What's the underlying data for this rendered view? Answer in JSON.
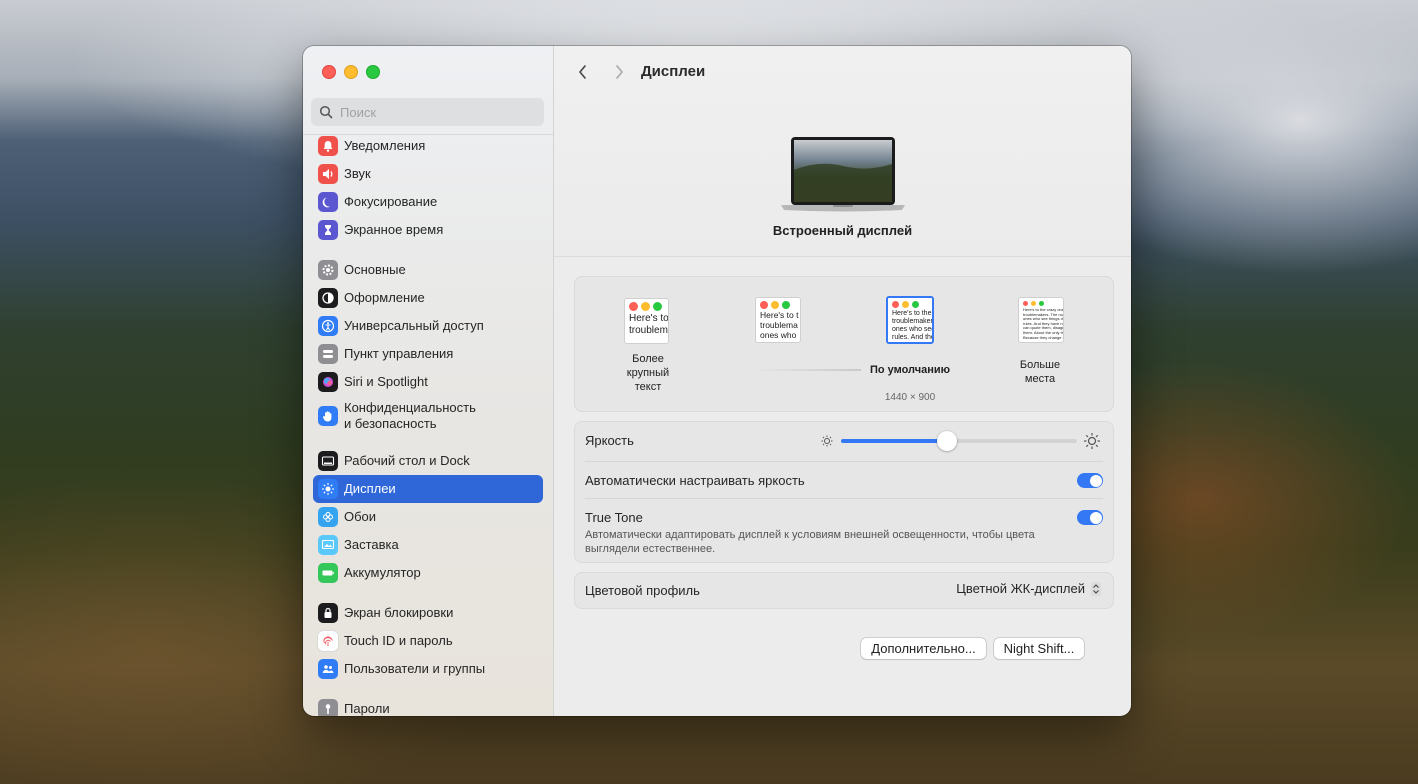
{
  "window": {
    "title": "Дисплеи"
  },
  "search": {
    "placeholder": "Поиск"
  },
  "sidebar": {
    "items": [
      {
        "label": "Уведомления",
        "icon": "bell-icon",
        "color": "#f0514a"
      },
      {
        "label": "Звук",
        "icon": "speaker-icon",
        "color": "#f0514a"
      },
      {
        "label": "Фокусирование",
        "icon": "moon-icon",
        "color": "#5b57d1"
      },
      {
        "label": "Экранное время",
        "icon": "hourglass-icon",
        "color": "#5b57d1"
      },
      {
        "label": "Основные",
        "icon": "gear-icon",
        "color": "#8e8e93"
      },
      {
        "label": "Оформление",
        "icon": "appearance-icon",
        "color": "#1c1c1e"
      },
      {
        "label": "Универсальный доступ",
        "icon": "accessibility-icon",
        "color": "#2f7cf6"
      },
      {
        "label": "Пункт управления",
        "icon": "control-center-icon",
        "color": "#8e8e93"
      },
      {
        "label": "Siri и Spotlight",
        "icon": "siri-icon",
        "color": "#1c1c1e"
      },
      {
        "label_line1": "Конфиденциальность",
        "label_line2": "и безопасность",
        "icon": "hand-icon",
        "color": "#2f7cf6"
      },
      {
        "label": "Рабочий стол и Dock",
        "icon": "dock-icon",
        "color": "#1c1c1e"
      },
      {
        "label": "Дисплеи",
        "icon": "sun-icon",
        "color": "#2f7cf6",
        "active": true
      },
      {
        "label": "Обои",
        "icon": "flower-icon",
        "color": "#35a4f0"
      },
      {
        "label": "Заставка",
        "icon": "screensaver-icon",
        "color": "#5ac8fa"
      },
      {
        "label": "Аккумулятор",
        "icon": "battery-icon",
        "color": "#34c759"
      },
      {
        "label": "Экран блокировки",
        "icon": "lock-icon",
        "color": "#1c1c1e"
      },
      {
        "label": "Touch ID и пароль",
        "icon": "fingerprint-icon",
        "color": "#ffffff"
      },
      {
        "label": "Пользователи и группы",
        "icon": "users-icon",
        "color": "#2f7cf6"
      },
      {
        "label": "Пароли",
        "icon": "key-icon",
        "color": "#8e8e93"
      }
    ]
  },
  "display": {
    "name": "Встроенный дисплей"
  },
  "resolution": {
    "options": [
      {
        "label_line1": "Более",
        "label_line2": "крупный",
        "label_line3": "текст",
        "thumb_text1": "Here's to t",
        "thumb_text2": "troublem"
      },
      {
        "thumb_text1": "Here's to t",
        "thumb_text2": "troublema",
        "thumb_text3": "ones who"
      },
      {
        "label": "По умолчанию",
        "size": "1440 × 900",
        "selected": true,
        "thumb_text1": "Here's to the c",
        "thumb_text2": "troublemakers",
        "thumb_text3": "ones who see t",
        "thumb_text4": "rules. And they"
      },
      {
        "label_line1": "Больше",
        "label_line2": "места",
        "thumb_text1": "Here's to the crazy one",
        "thumb_text2": "troublemakers. The rou",
        "thumb_text3": "ones who see things di",
        "thumb_text4": "rules. And they have no",
        "thumb_text5": "can quote them, disagr",
        "thumb_text6": "them. About the only th",
        "thumb_text7": "Because they change t"
      }
    ]
  },
  "brightness": {
    "label": "Яркость",
    "value": 0.45
  },
  "auto_brightness": {
    "label": "Автоматически настраивать яркость",
    "on": true
  },
  "true_tone": {
    "label": "True Tone",
    "description_line1": "Автоматически адаптировать дисплей к условиям внешней освещенности, чтобы цвета",
    "description_line2": "выглядели естественнее.",
    "on": true
  },
  "color_profile": {
    "label": "Цветовой профиль",
    "value": "Цветной ЖК-дисплей"
  },
  "buttons": {
    "advanced": "Дополнительно...",
    "night_shift": "Night Shift...",
    "help": "?"
  }
}
